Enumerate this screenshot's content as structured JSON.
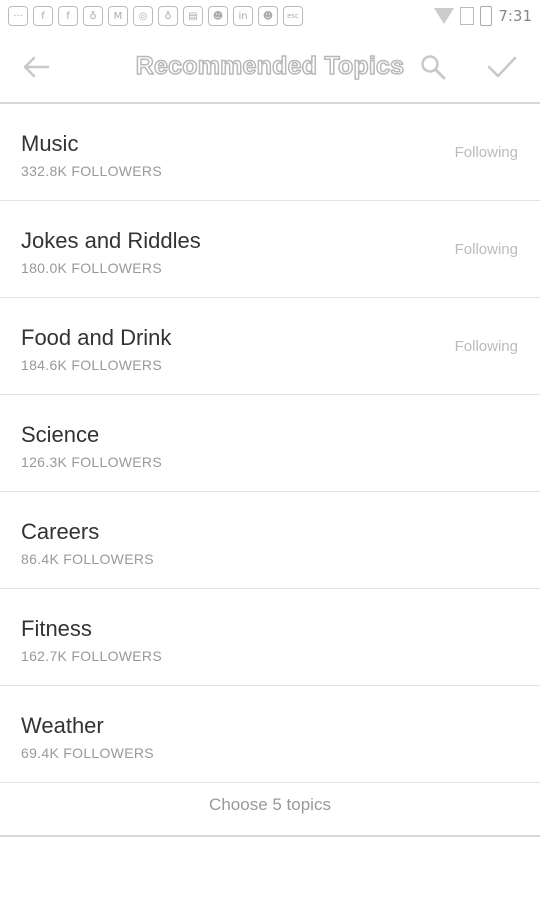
{
  "statusbar": {
    "icons": [
      "more-icon",
      "facebook-icon",
      "facebook-icon",
      "notification-icon",
      "gmail-icon",
      "messenger-icon",
      "notification-icon",
      "sim-icon",
      "cat-icon",
      "linkedin-icon",
      "cat-icon",
      "esc-icon"
    ],
    "icon_glyphs": [
      "···",
      "f",
      "f",
      "♁",
      "M",
      "◎",
      "♁",
      "▤",
      "☻",
      "in",
      "☻",
      "esc"
    ],
    "time": "7:31"
  },
  "appbar": {
    "title": "Recommended Topics"
  },
  "topics": [
    {
      "name": "Music",
      "followers": "332.8K FOLLOWERS",
      "following": "Following"
    },
    {
      "name": "Jokes and Riddles",
      "followers": "180.0K FOLLOWERS",
      "following": "Following"
    },
    {
      "name": "Food and Drink",
      "followers": "184.6K FOLLOWERS",
      "following": "Following"
    },
    {
      "name": "Science",
      "followers": "126.3K FOLLOWERS",
      "following": ""
    },
    {
      "name": "Careers",
      "followers": "86.4K FOLLOWERS",
      "following": ""
    },
    {
      "name": "Fitness",
      "followers": "162.7K FOLLOWERS",
      "following": ""
    },
    {
      "name": "Weather",
      "followers": "69.4K FOLLOWERS",
      "following": ""
    }
  ],
  "footer": {
    "label": "Choose 5 topics"
  }
}
